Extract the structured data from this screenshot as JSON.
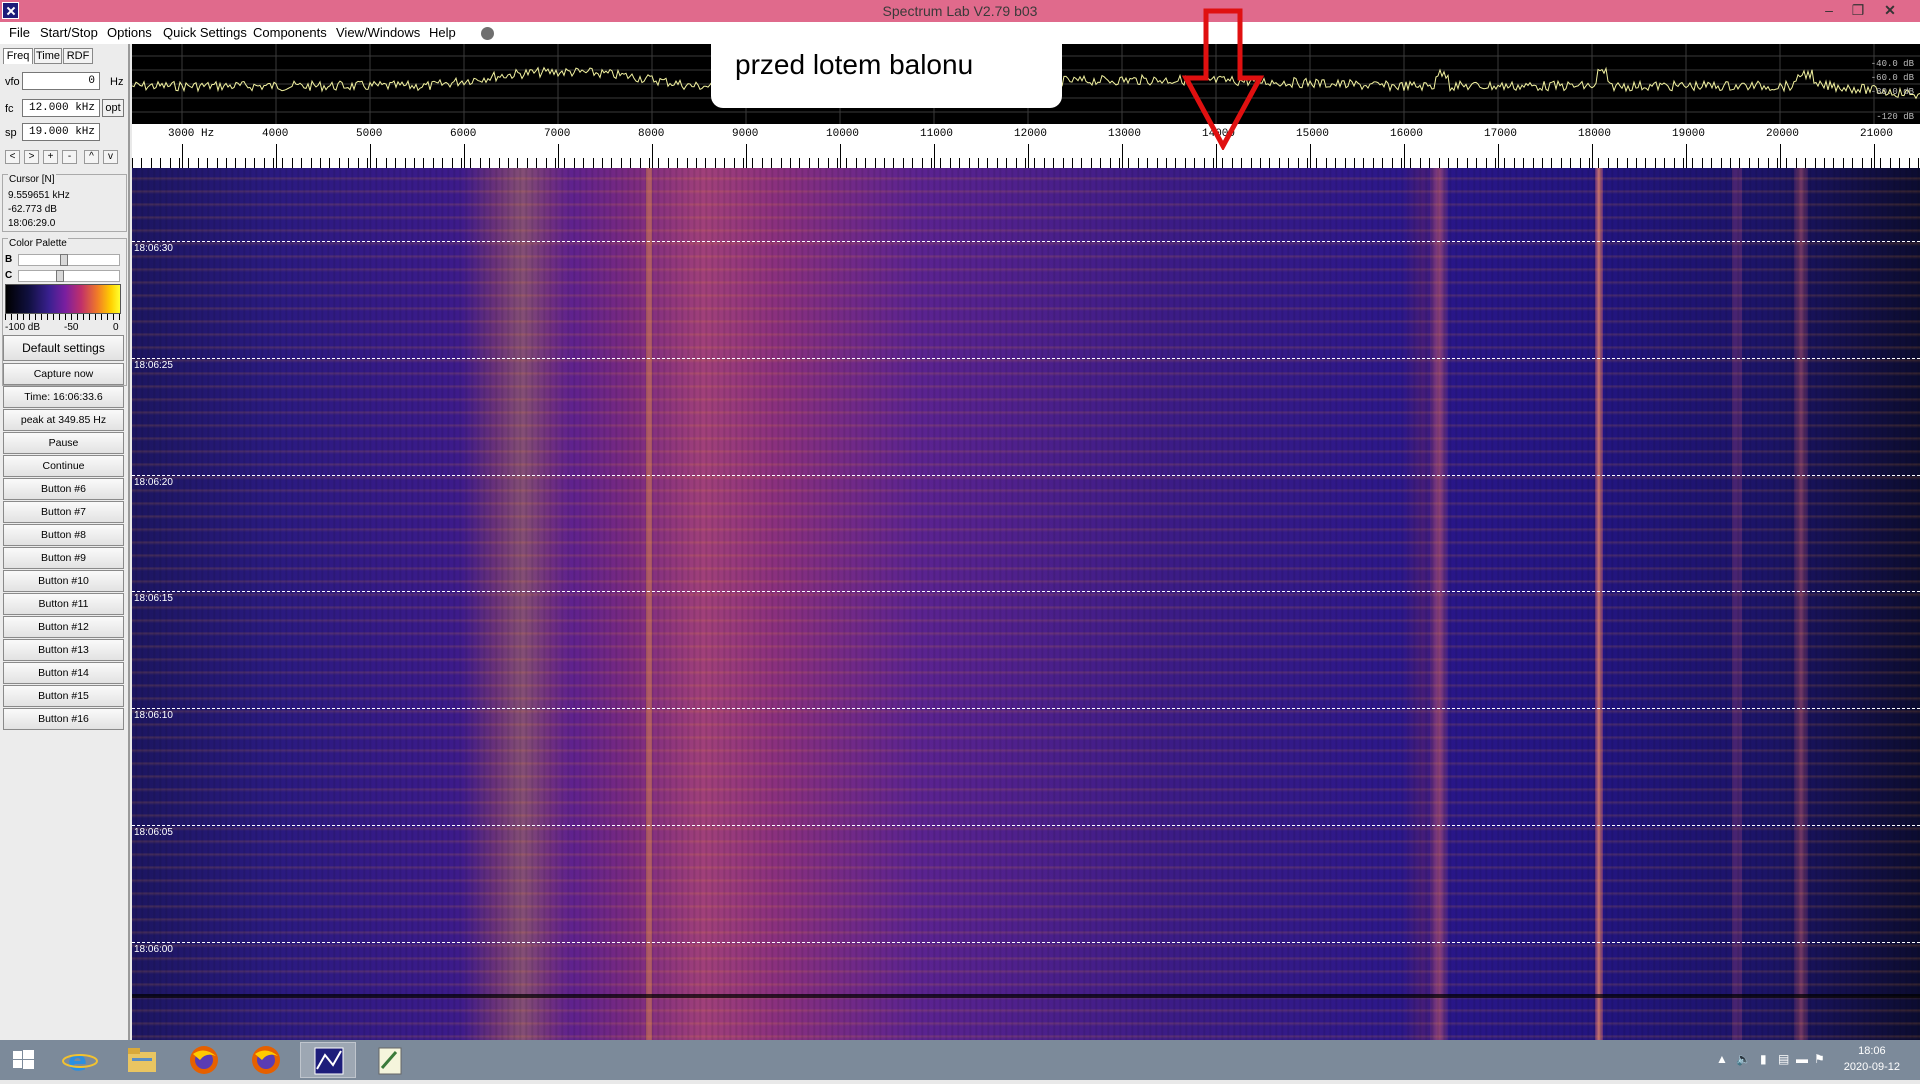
{
  "window": {
    "title": "Spectrum Lab V2.79 b03",
    "controls": [
      "minimize-icon",
      "restore-icon",
      "close-icon"
    ]
  },
  "menu": [
    "File",
    "Start/Stop",
    "Options",
    "Quick Settings",
    "Components",
    "View/Windows",
    "Help"
  ],
  "tabs": [
    "Freq",
    "Time",
    "RDF"
  ],
  "frequency": {
    "vfo_label": "vfo",
    "vfo_value": "0",
    "vfo_unit": "Hz",
    "fc_label": "fc",
    "fc_value": "12.000 kHz",
    "fc_opt": "opt",
    "sp_label": "sp",
    "sp_value": "19.000 kHz",
    "nav": [
      "<",
      ">",
      "+",
      "-",
      "^",
      "v"
    ]
  },
  "cursor": {
    "title": "Cursor [N]",
    "freq": "9.559651 kHz",
    "level": "-62.773 dB",
    "time": "18:06:29.0"
  },
  "palette": {
    "title": "Color Palette",
    "b_label": "B",
    "c_label": "C",
    "b_level": 0.45,
    "c_level": 0.4,
    "scale": [
      "-100 dB",
      "-50",
      "0"
    ]
  },
  "buttons": [
    "Default settings",
    "Capture now",
    "Time:  16:06:33.6",
    "peak at 349.85 Hz",
    "Pause",
    "Continue",
    "Button #6",
    "Button #7",
    "Button #8",
    "Button #9",
    "Button #10",
    "Button #11",
    "Button #12",
    "Button #13",
    "Button #14",
    "Button #15",
    "Button #16"
  ],
  "spectrum": {
    "db_labels": [
      "-40.0 dB",
      "-60.0 dB",
      "-80.0 dB",
      "-120 dB"
    ]
  },
  "freq_axis": {
    "labels": [
      "3000 Hz",
      "4000",
      "5000",
      "6000",
      "7000",
      "8000",
      "9000",
      "10000",
      "11000",
      "12000",
      "13000",
      "14000",
      "15000",
      "16000",
      "17000",
      "18000",
      "19000",
      "20000",
      "21000"
    ]
  },
  "waterfall": {
    "time_labels": [
      "18:06:30",
      "18:06:25",
      "18:06:20",
      "18:06:15",
      "18:06:10",
      "18:06:05",
      "18:06:00"
    ]
  },
  "annotation": {
    "text": "przed lotem balonu",
    "arrow_color": "#e01010"
  },
  "taskbar": {
    "apps": [
      "windows-start-icon",
      "internet-explorer-icon",
      "file-explorer-icon",
      "firefox-icon",
      "firefox-icon",
      "spectrum-lab-icon",
      "notepad-icon"
    ],
    "clock_time": "18:06",
    "clock_date": "2020-09-12"
  }
}
